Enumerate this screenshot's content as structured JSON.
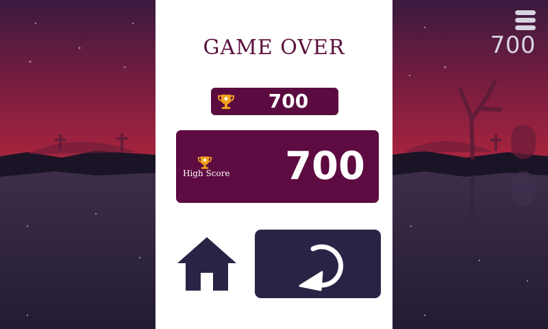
{
  "hud": {
    "menu_icon": "hamburger-menu-icon",
    "score": "700"
  },
  "panel": {
    "title": "GAME OVER",
    "current_score": "700",
    "high_score_label": "High Score",
    "high_score": "700",
    "trophy_icon": "trophy-icon",
    "home_icon": "home-icon",
    "replay_icon": "replay-icon"
  },
  "colors": {
    "panel_bg": "#ffffff",
    "accent_maroon": "#5d0b41",
    "button_dark": "#2b2346",
    "trophy_gold": "#f0a11c"
  }
}
